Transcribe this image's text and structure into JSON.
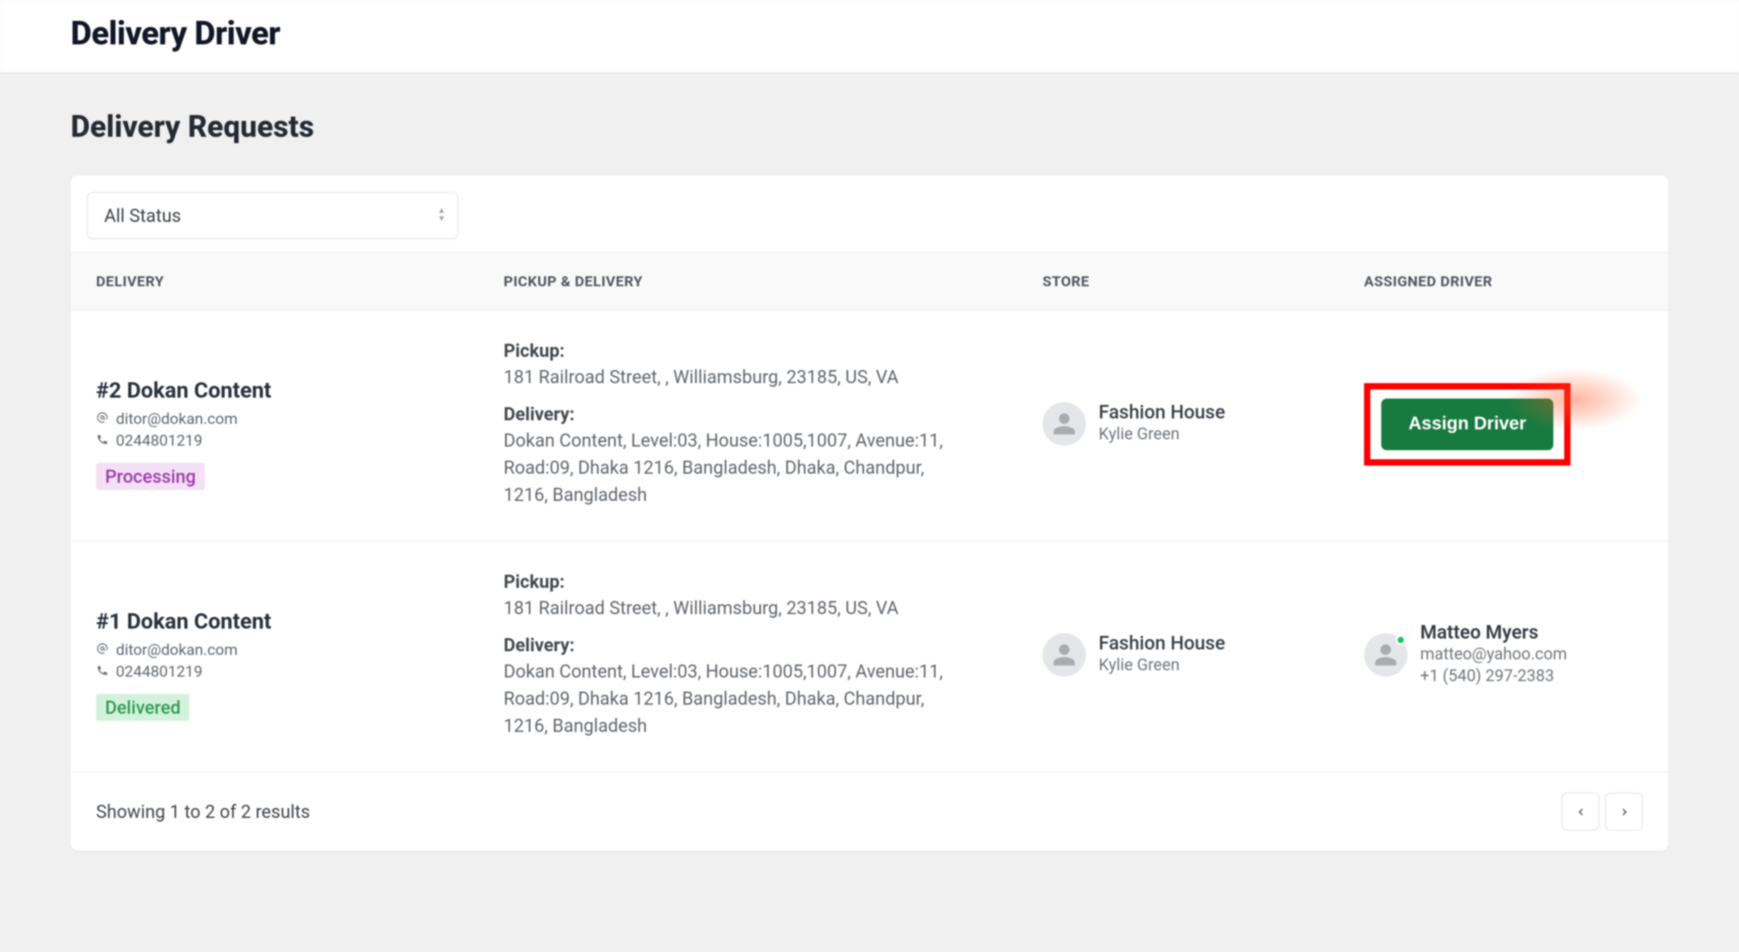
{
  "header": {
    "title": "Delivery Driver"
  },
  "section": {
    "title": "Delivery Requests"
  },
  "filter": {
    "selected": "All Status"
  },
  "columns": {
    "delivery": "DELIVERY",
    "pickup_delivery": "PICKUP & DELIVERY",
    "store": "STORE",
    "assigned_driver": "ASSIGNED DRIVER"
  },
  "labels": {
    "pickup": "Pickup:",
    "delivery": "Delivery:",
    "assign_button": "Assign Driver"
  },
  "rows": [
    {
      "order_title": "#2 Dokan Content",
      "email": "ditor@dokan.com",
      "phone": "0244801219",
      "status": "Processing",
      "status_class": "processing",
      "pickup": "181 Railroad Street, , Williamsburg, 23185, US, VA",
      "delivery": "Dokan Content, Level:03, House:1005,1007, Avenue:11, Road:09, Dhaka 1216, Bangladesh, Dhaka, Chandpur, 1216, Bangladesh",
      "store": {
        "name": "Fashion House",
        "person": "Kylie Green"
      },
      "driver": null
    },
    {
      "order_title": "#1 Dokan Content",
      "email": "ditor@dokan.com",
      "phone": "0244801219",
      "status": "Delivered",
      "status_class": "delivered",
      "pickup": "181 Railroad Street, , Williamsburg, 23185, US, VA",
      "delivery": "Dokan Content, Level:03, House:1005,1007, Avenue:11, Road:09, Dhaka 1216, Bangladesh, Dhaka, Chandpur, 1216, Bangladesh",
      "store": {
        "name": "Fashion House",
        "person": "Kylie Green"
      },
      "driver": {
        "name": "Matteo Myers",
        "email": "matteo@yahoo.com",
        "phone": "+1 (540) 297-2383"
      }
    }
  ],
  "footer": {
    "results_text": "Showing 1 to 2 of 2 results"
  }
}
